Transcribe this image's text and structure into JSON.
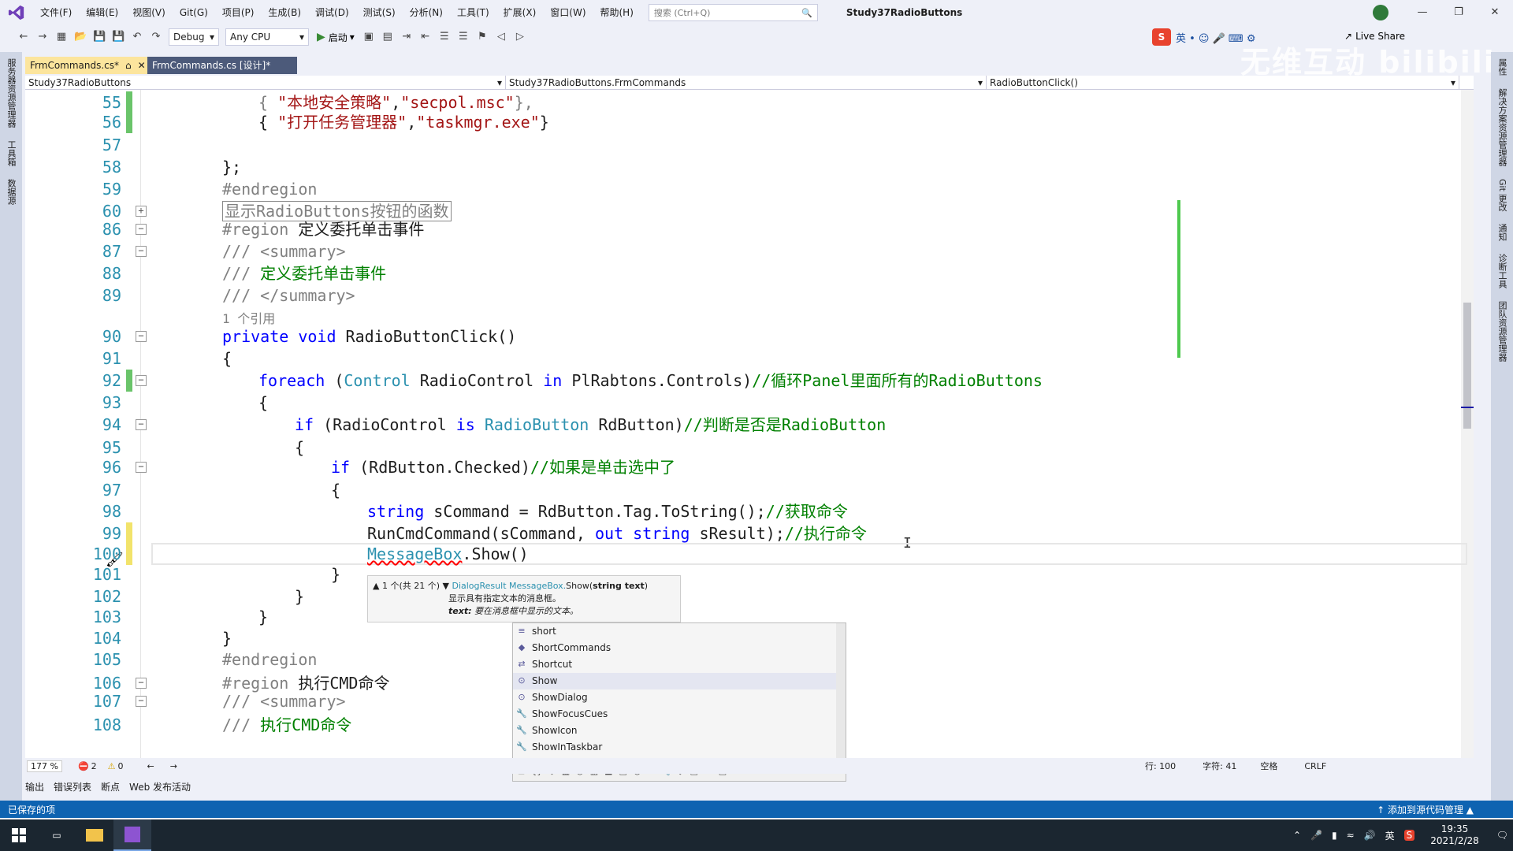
{
  "menubar": {
    "items": [
      "文件(F)",
      "编辑(E)",
      "视图(V)",
      "Git(G)",
      "项目(P)",
      "生成(B)",
      "调试(D)",
      "测试(S)",
      "分析(N)",
      "工具(T)",
      "扩展(X)",
      "窗口(W)",
      "帮助(H)"
    ],
    "search_placeholder": "搜索 (Ctrl+Q)",
    "project_title": "Study37RadioButtons"
  },
  "toolbar": {
    "config": "Debug",
    "platform": "Any CPU",
    "start_label": "启动",
    "liveshare_label": "Live Share"
  },
  "watermark": "无维互动 bilibili",
  "doc_tabs": [
    {
      "label": "FrmCommands.cs*",
      "active": true
    },
    {
      "label": "FrmCommands.cs [设计]*",
      "active": false
    }
  ],
  "navbar": {
    "project": "Study37RadioButtons",
    "class": "Study37RadioButtons.FrmCommands",
    "member": "RadioButtonClick()"
  },
  "code_lines": [
    {
      "n": "55",
      "html": "<span class='gr'>{ </span><span class='str'>\"本地安全策略\"</span>,<span class='str'>\"secpol.msc\"</span><span class='gr'>},</span>",
      "indent": 1,
      "chg": "green"
    },
    {
      "n": "56",
      "html": "{ <span class='str'>\"打开任务管理器\"</span>,<span class='str'>\"taskmgr.exe\"</span>}",
      "indent": 1,
      "chg": "green"
    },
    {
      "n": "57",
      "html": "",
      "indent": 0
    },
    {
      "n": "58",
      "html": "};",
      "indent": 0
    },
    {
      "n": "59",
      "html": "<span class='gr'>#endregion</span>",
      "indent": 0
    },
    {
      "n": "60",
      "html": "<span class='gr' style='border:1px solid #888;padding:0 2px'>显示RadioButtons按钮的函数</span>",
      "indent": 0,
      "fold": "+"
    },
    {
      "n": "86",
      "html": "<span class='gr'>#region</span> 定义委托单击事件",
      "indent": 0,
      "fold": "-"
    },
    {
      "n": "87",
      "html": "<span class='gr'>/// &lt;summary&gt;</span>",
      "indent": 0,
      "fold": "-"
    },
    {
      "n": "88",
      "html": "<span class='gr'>/// </span><span class='cm'>定义委托单击事件</span>",
      "indent": 0
    },
    {
      "n": "89",
      "html": "<span class='gr'>/// &lt;/summary&gt;</span>",
      "indent": 0
    },
    {
      "n": "",
      "html": "<span class='gr' style='font-size:16px'>1 个引用</span>",
      "indent": 0,
      "ref": true
    },
    {
      "n": "90",
      "html": "<span class='kw'>private</span> <span class='kw'>void</span> RadioButtonClick()",
      "indent": 0,
      "fold": "-"
    },
    {
      "n": "91",
      "html": "{",
      "indent": 0
    },
    {
      "n": "92",
      "html": "<span class='kw'>foreach</span> (<span class='ty'>Control</span> RadioControl <span class='kw'>in</span> PlRabtons.Controls)<span class='cm'>//循环Panel里面所有的RadioButtons</span>",
      "indent": 1,
      "fold": "-",
      "chg": "green"
    },
    {
      "n": "93",
      "html": "{",
      "indent": 1
    },
    {
      "n": "94",
      "html": "<span class='kw'>if</span> (RadioControl <span class='kw'>is</span> <span class='ty'>RadioButton</span> RdButton)<span class='cm'>//判断是否是RadioButton</span>",
      "indent": 2,
      "fold": "-"
    },
    {
      "n": "95",
      "html": "{",
      "indent": 2
    },
    {
      "n": "96",
      "html": "<span class='kw'>if</span> (RdButton.Checked)<span class='cm'>//如果是单击选中了</span>",
      "indent": 3,
      "fold": "-"
    },
    {
      "n": "97",
      "html": "{",
      "indent": 3
    },
    {
      "n": "98",
      "html": "<span class='kw'>string</span> sCommand = RdButton.Tag.ToString();<span class='cm'>//获取命令</span>",
      "indent": 4
    },
    {
      "n": "99",
      "html": "RunCmdCommand(sCommand, <span class='kw'>out</span> <span class='kw'>string</span> sResult);<span class='cm'>//执行命令</span>",
      "indent": 4,
      "chg": "yellow"
    },
    {
      "n": "100",
      "html": "<span class='ty' style='text-decoration:underline wavy red'>MessageBox</span>.Show()",
      "indent": 4,
      "chg": "yellow",
      "cur": true
    },
    {
      "n": "101",
      "html": "}",
      "indent": 3
    },
    {
      "n": "102",
      "html": "}",
      "indent": 2
    },
    {
      "n": "103",
      "html": "}",
      "indent": 1
    },
    {
      "n": "104",
      "html": "}",
      "indent": 0
    },
    {
      "n": "105",
      "html": "<span class='gr'>#endregion</span>",
      "indent": 0
    },
    {
      "n": "106",
      "html": "<span class='gr'>#region</span> 执行CMD命令",
      "indent": 0,
      "fold": "-"
    },
    {
      "n": "107",
      "html": "<span class='gr'>/// &lt;summary&gt;</span>",
      "indent": 0,
      "fold": "-"
    },
    {
      "n": "108",
      "html": "<span class='gr'>/// </span><span class='cm'>执行CMD命令</span>",
      "indent": 0
    }
  ],
  "param_info": {
    "counter": "▲ 1 个(共 21 个) ▼",
    "signature_prefix": "DialogResult MessageBox.",
    "signature_method": "Show(",
    "signature_param": "string text",
    "signature_suffix": ")",
    "description": "显示具有指定文本的消息框。",
    "param_name": "text:",
    "param_desc": "要在消息框中显示的文本。"
  },
  "completion_items": [
    {
      "label": "short",
      "icon": "≡"
    },
    {
      "label": "ShortCommands",
      "icon": "◆"
    },
    {
      "label": "Shortcut",
      "icon": "⇄"
    },
    {
      "label": "Show",
      "icon": "⊙",
      "selected": true
    },
    {
      "label": "ShowDialog",
      "icon": "⊙"
    },
    {
      "label": "ShowFocusCues",
      "icon": "🔧"
    },
    {
      "label": "ShowIcon",
      "icon": "🔧"
    },
    {
      "label": "ShowInTaskbar",
      "icon": "🔧"
    }
  ],
  "editor_status": {
    "zoom": "177 %",
    "errors": "2",
    "warnings": "0",
    "line": "行: 100",
    "char": "字符: 41",
    "spaces": "空格",
    "eol": "CRLF"
  },
  "panel_tabs": [
    "输出",
    "错误列表",
    "断点",
    "Web 发布活动"
  ],
  "statusbar": {
    "left": "已保存的项",
    "right": "↑ 添加到源代码管理 ▲"
  },
  "taskbar": {
    "time": "19:35",
    "date": "2021/2/28",
    "ime": "英"
  },
  "side_rail_left": [
    "服务器资源管理器",
    "工具箱",
    "数据源"
  ],
  "side_rail_right": [
    "属性",
    "解决方案资源管理器",
    "Git 更改",
    "通知",
    "诊断工具",
    "团队资源管理器"
  ]
}
